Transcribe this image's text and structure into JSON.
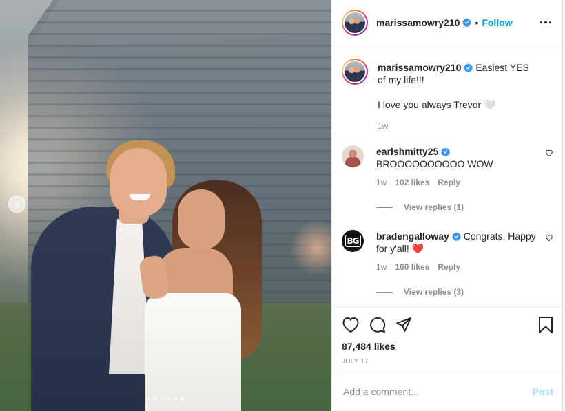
{
  "post": {
    "author": "marissamowry210",
    "follow_label": "Follow",
    "separator": "•",
    "caption_line1": "Easiest YES of my life!!!",
    "caption_line2": "I love you always Trevor 🤍",
    "caption_age": "1w",
    "photo_count": 6,
    "active_photo_index": 6
  },
  "comments": [
    {
      "username": "earlshmitty25",
      "verified": true,
      "text": "BROOOOOOOOOO WOW",
      "age": "1w",
      "likes": "102 likes",
      "reply_label": "Reply",
      "view_replies": "View replies (1)"
    },
    {
      "username": "bradengalloway",
      "verified": true,
      "text": "Congrats, Happy for y'all! ❤️",
      "avatar_text": "BG",
      "age": "1w",
      "likes": "160 likes",
      "reply_label": "Reply",
      "view_replies": "View replies (3)"
    }
  ],
  "footer": {
    "likes_count": "87,484 likes",
    "date": "JULY 17",
    "comment_placeholder": "Add a comment...",
    "post_label": "Post"
  },
  "colors": {
    "accent": "#0095f6",
    "verified": "#3897f0",
    "muted": "#8e8e8e",
    "text": "#262626"
  },
  "icons": [
    "chevron-left-icon",
    "verified-badge-icon",
    "more-icon",
    "heart-icon",
    "comment-icon",
    "share-icon",
    "bookmark-icon"
  ]
}
